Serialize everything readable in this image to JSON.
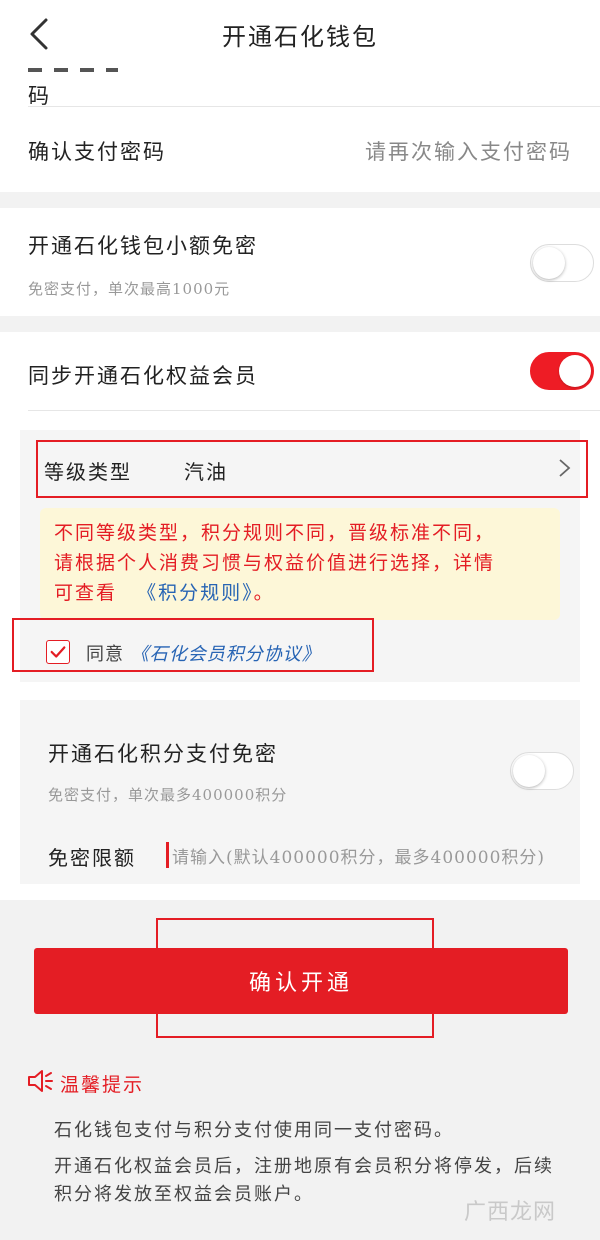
{
  "header": {
    "title": "开通石化钱包"
  },
  "password": {
    "partial_label": "码",
    "confirm_label": "确认支付密码",
    "confirm_placeholder": "请再次输入支付密码"
  },
  "small_free": {
    "title": "开通石化钱包小额免密",
    "subtitle": "免密支付，单次最高1000元",
    "enabled": false
  },
  "member": {
    "title": "同步开通石化权益会员",
    "enabled": true,
    "level_label": "等级类型",
    "level_value": "汽油",
    "notice_line1": "不同等级类型，积分规则不同，晋级标准不同，",
    "notice_line2": "请根据个人消费习惯与权益价值进行选择，详情",
    "notice_line3_prefix": "可查看",
    "notice_link": "《积分规则》",
    "notice_line3_suffix": "。",
    "agree_prefix": "同意",
    "agree_link": "《石化会员积分协议》",
    "agree_checked": true
  },
  "points_free": {
    "title": "开通石化积分支付免密",
    "subtitle": "免密支付，单次最多400000积分",
    "enabled": false,
    "limit_label": "免密限额",
    "limit_placeholder": "请输入(默认400000积分，最多400000积分)"
  },
  "confirm_button": "确认开通",
  "tips": {
    "title": "温馨提示",
    "line1": "石化钱包支付与积分支付使用同一支付密码。",
    "line2": "开通石化权益会员后，注册地原有会员积分将停发，后续",
    "line3": "积分将发放至权益会员账户。"
  },
  "watermark": "广西龙网",
  "colors": {
    "accent": "#e41d24",
    "link": "#2764b4",
    "notice_bg": "#fdf7d8"
  }
}
